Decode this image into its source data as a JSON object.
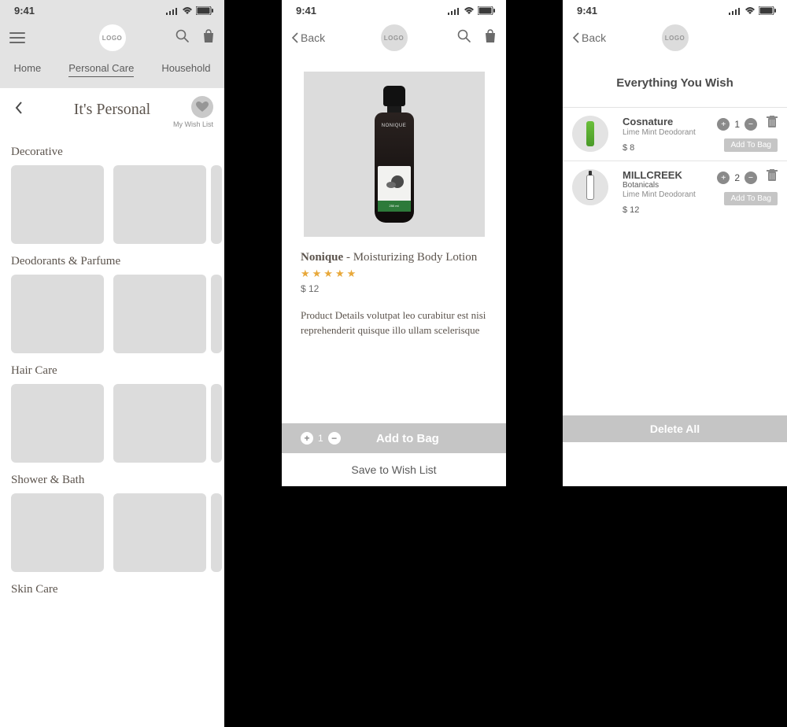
{
  "status": {
    "time": "9:41"
  },
  "logo": "LOGO",
  "back_label": "Back",
  "screen1": {
    "tabs": {
      "home": "Home",
      "personal": "Personal Care",
      "household": "Household"
    },
    "title": "It's Personal",
    "wishlist_label": "My Wish List",
    "sections": {
      "decorative": "Decorative",
      "deodorants": "Deodorants & Parfume",
      "hair": "Hair Care",
      "shower": "Shower & Bath",
      "skin": "Skin Care"
    }
  },
  "screen2": {
    "brand": "Nonique",
    "separator": " - ",
    "product": "Moisturizing Body Lotion",
    "rating": 5,
    "price": "$ 12",
    "description": "Product Details volutpat leo curabitur est nisi reprehenderit quisque illo ullam scelerisque",
    "qty": "1",
    "add_to_bag": "Add to Bag",
    "save_wishlist": "Save to Wish List",
    "bottle_brand": "NONIQUE",
    "bottle_size": "250 ml"
  },
  "screen3": {
    "title": "Everything You Wish",
    "items": [
      {
        "brand": "Cosnature",
        "sub": "",
        "variant": "Lime Mint Deodorant",
        "price": "$ 8",
        "qty": "1"
      },
      {
        "brand": "MILLCREEK",
        "sub": "Botanicals",
        "variant": "Lime Mint Deodorant",
        "price": "$ 12",
        "qty": "2"
      }
    ],
    "add_to_bag": "Add To Bag",
    "delete_all": "Delete All"
  }
}
